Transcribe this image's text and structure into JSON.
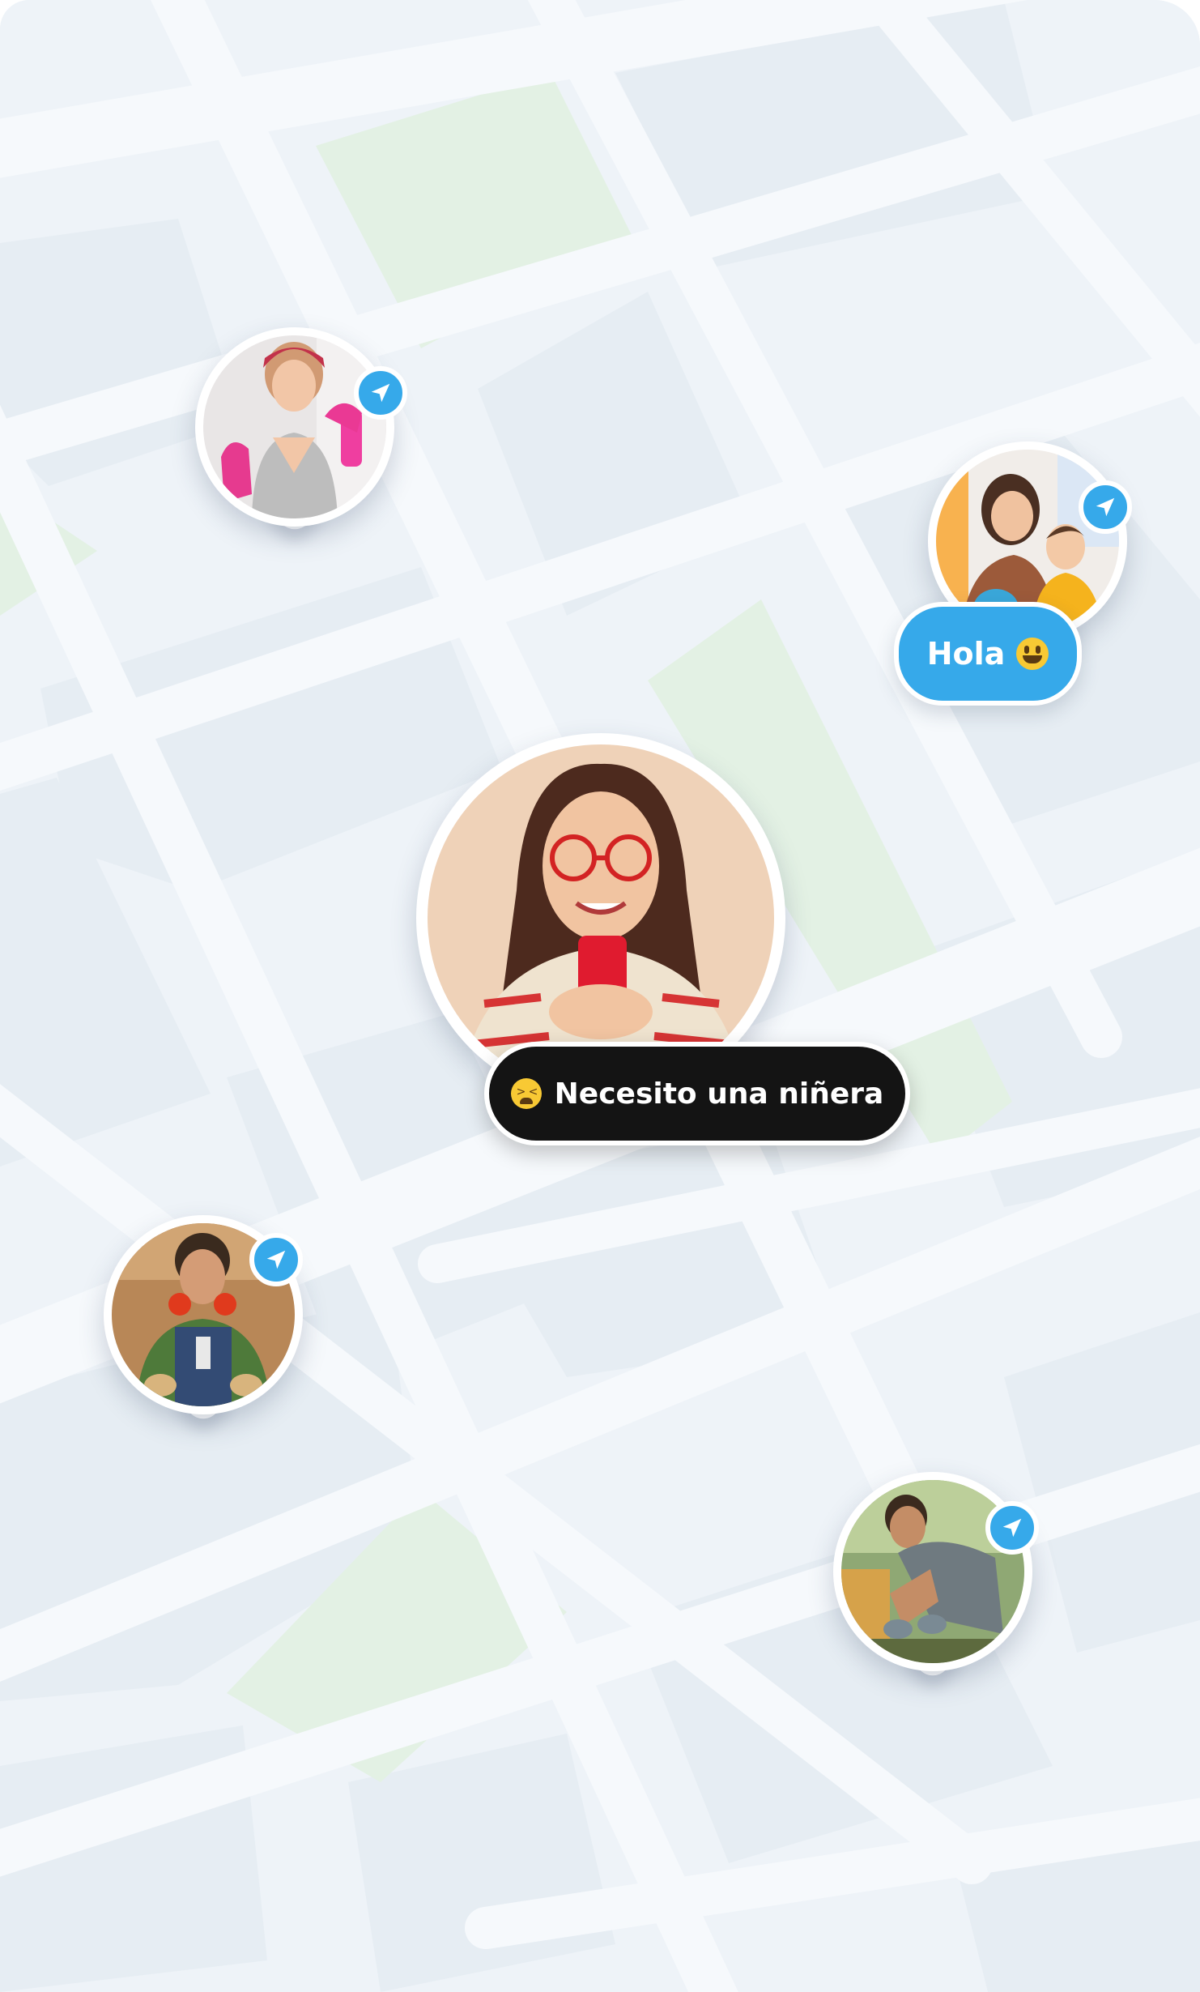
{
  "map": {
    "colors": {
      "background": "#eef3f8",
      "block": "#e6edf3",
      "road": "#f6f9fc",
      "park": "#e3f1e4",
      "accent": "#36a9ea",
      "bubble_dark": "#141414"
    }
  },
  "pins": [
    {
      "id": "cleaner",
      "subject": "woman cleaning with pink gloves and spray bottle",
      "badge_icon": "navigation-arrow-icon"
    },
    {
      "id": "nanny",
      "subject": "woman playing with a child",
      "badge_icon": "navigation-arrow-icon"
    },
    {
      "id": "requester",
      "subject": "woman with red glasses using a smartphone"
    },
    {
      "id": "worker",
      "subject": "smiling worker with ear protectors",
      "badge_icon": "navigation-arrow-icon"
    },
    {
      "id": "gardener",
      "subject": "man gardening with gloves",
      "badge_icon": "navigation-arrow-icon"
    }
  ],
  "bubbles": {
    "greeting": {
      "text": "Hola",
      "emoji": "grinning-face-emoji"
    },
    "request": {
      "text": "Necesito una niñera",
      "emoji": "tired-face-emoji"
    }
  }
}
